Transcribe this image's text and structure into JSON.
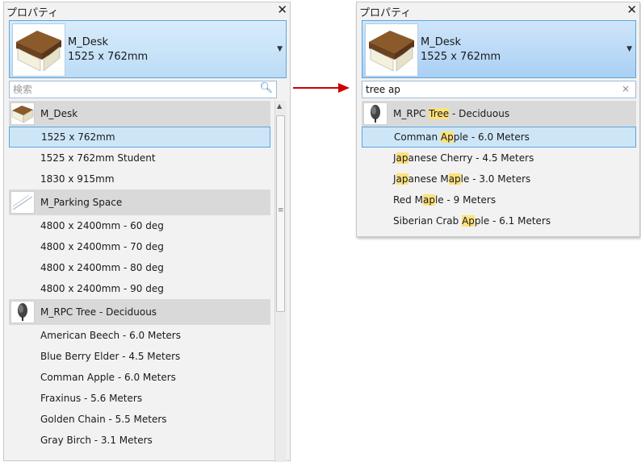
{
  "left": {
    "title": "プロパティ",
    "close": "✕",
    "selected_type": {
      "name": "M_Desk",
      "size": "1525 x 762mm"
    },
    "search": {
      "placeholder": "検索",
      "value": ""
    },
    "groups": [
      {
        "name": "M_Desk",
        "icon": "desk-icon",
        "items": [
          "1525 x 762mm",
          "1525 x 762mm Student",
          "1830 x 915mm"
        ]
      },
      {
        "name": "M_Parking Space",
        "icon": "parking-space-icon",
        "items": [
          "4800 x 2400mm - 60 deg",
          "4800 x 2400mm - 70 deg",
          "4800 x 2400mm - 80 deg",
          "4800 x 2400mm - 90 deg"
        ]
      },
      {
        "name": "M_RPC Tree - Deciduous",
        "icon": "tree-icon",
        "items": [
          "American Beech - 6.0 Meters",
          "Blue Berry Elder - 4.5 Meters",
          "Comman Apple - 6.0 Meters",
          "Fraxinus - 5.6 Meters",
          "Golden Chain - 5.5 Meters",
          "Gray Birch - 3.1 Meters"
        ]
      }
    ]
  },
  "right": {
    "title": "プロパティ",
    "close": "✕",
    "selected_type": {
      "name": "M_Desk",
      "size": "1525 x 762mm"
    },
    "search": {
      "value": "tree ap",
      "clear": "×"
    },
    "group": {
      "parts": [
        "M_RPC ",
        "Tree",
        " - Deciduous"
      ]
    },
    "items": [
      [
        "Comman ",
        "Ap",
        "ple - 6.0 Meters"
      ],
      [
        "J",
        "ap",
        "anese Cherry - 4.5 Meters"
      ],
      [
        "J",
        "ap",
        "anese M",
        "ap",
        "le - 3.0 Meters"
      ],
      [
        "Red M",
        "ap",
        "le - 9 Meters"
      ],
      [
        "Siberian Crab ",
        "Ap",
        "ple - 6.1 Meters"
      ]
    ]
  },
  "colors": {
    "accent": "#5aa6e0",
    "selection": "#cde6f7",
    "highlight": "#ffe17a",
    "arrow": "#cc0000"
  }
}
